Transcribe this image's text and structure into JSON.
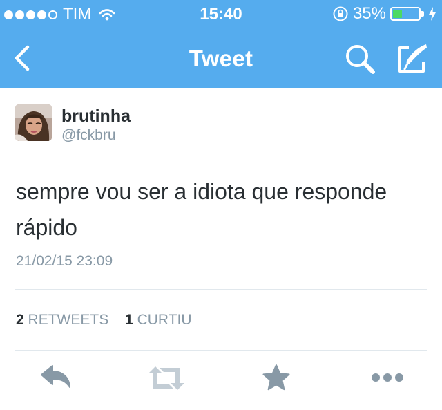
{
  "status_bar": {
    "carrier": "TIM",
    "time": "15:40",
    "battery_percent": "35%",
    "battery_level": 0.35,
    "icons": [
      "signal-dots-icon",
      "wifi-icon",
      "rotation-lock-icon",
      "battery-icon",
      "charging-bolt-icon"
    ]
  },
  "nav": {
    "title": "Tweet",
    "back_icon": "chevron-left-icon",
    "search_icon": "search-icon",
    "compose_icon": "compose-icon"
  },
  "tweet": {
    "name": "brutinha",
    "handle": "@fckbru",
    "text": "sempre vou ser a idiota que responde rápido",
    "timestamp": "21/02/15 23:09",
    "retweets_count": "2",
    "retweets_label": "RETWEETS",
    "likes_count": "1",
    "likes_label": "CURTIU"
  },
  "actions": {
    "icons": [
      "reply-icon",
      "retweet-icon",
      "favorite-star-icon",
      "more-icon"
    ]
  },
  "colors": {
    "header_blue": "#55acee",
    "action_gray": "#8899a6",
    "battery_green": "#4cd964"
  }
}
